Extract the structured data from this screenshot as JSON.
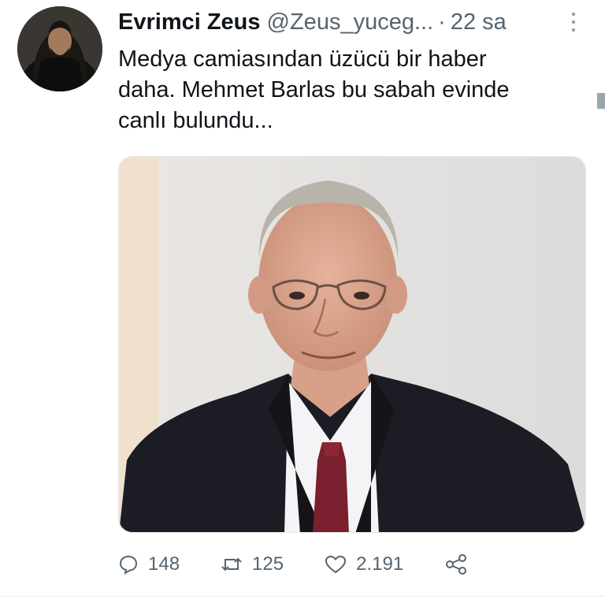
{
  "tweet": {
    "author": {
      "display_name": "Evrimci Zeus",
      "handle": "@Zeus_yuceg...",
      "separator": "·",
      "time": "22 sa"
    },
    "text": "Medya camiasından üzücü bir haber\ndaha. Mehmet Barlas bu sabah evinde\ncanlı bulundu...",
    "actions": {
      "reply_count": "148",
      "retweet_count": "125",
      "like_count": "2.191"
    }
  },
  "icons": {
    "more": "more-vertical-icon",
    "reply": "reply-icon",
    "retweet": "retweet-icon",
    "like": "heart-icon",
    "share": "share-icon"
  },
  "colors": {
    "text": "#0f1419",
    "secondary": "#536471",
    "background": "#ffffff"
  }
}
